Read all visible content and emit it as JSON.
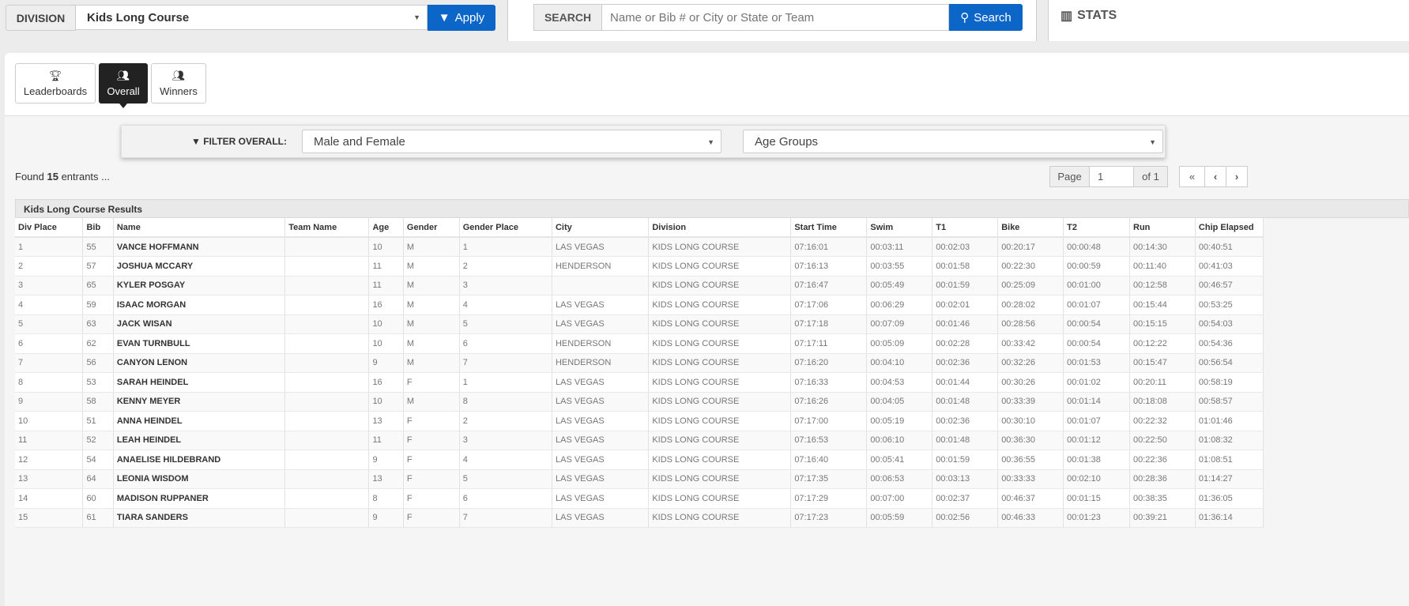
{
  "division": {
    "label": "DIVISION",
    "selected": "Kids Long Course",
    "apply": "Apply"
  },
  "search": {
    "label": "SEARCH",
    "placeholder": "Name or Bib # or City or State or Team",
    "button": "Search"
  },
  "stats": {
    "label": "STATS"
  },
  "tabs": [
    {
      "label": "Leaderboards",
      "icon": "trophy-icon"
    },
    {
      "label": "Overall",
      "icon": "users-icon",
      "active": true
    },
    {
      "label": "Winners",
      "icon": "users-icon"
    }
  ],
  "filter": {
    "label": "FILTER OVERALL:",
    "gender": "Male and Female",
    "age": "Age Groups"
  },
  "found": {
    "prefix": "Found ",
    "count": "15",
    "suffix": " entrants ..."
  },
  "pagination": {
    "page_label": "Page",
    "page": "1",
    "of": "of 1"
  },
  "results": {
    "title": "Kids Long Course Results",
    "columns": [
      "Div Place",
      "Bib",
      "Name",
      "Team Name",
      "Age",
      "Gender",
      "Gender Place",
      "City",
      "Division",
      "Start Time",
      "Swim",
      "T1",
      "Bike",
      "T2",
      "Run",
      "Chip Elapsed"
    ],
    "rows": [
      [
        "1",
        "55",
        "VANCE HOFFMANN",
        "",
        "10",
        "M",
        "1",
        "LAS VEGAS",
        "KIDS LONG COURSE",
        "07:16:01",
        "00:03:11",
        "00:02:03",
        "00:20:17",
        "00:00:48",
        "00:14:30",
        "00:40:51"
      ],
      [
        "2",
        "57",
        "JOSHUA MCCARY",
        "",
        "11",
        "M",
        "2",
        "HENDERSON",
        "KIDS LONG COURSE",
        "07:16:13",
        "00:03:55",
        "00:01:58",
        "00:22:30",
        "00:00:59",
        "00:11:40",
        "00:41:03"
      ],
      [
        "3",
        "65",
        "KYLER POSGAY",
        "",
        "11",
        "M",
        "3",
        "",
        "KIDS LONG COURSE",
        "07:16:47",
        "00:05:49",
        "00:01:59",
        "00:25:09",
        "00:01:00",
        "00:12:58",
        "00:46:57"
      ],
      [
        "4",
        "59",
        "ISAAC MORGAN",
        "",
        "16",
        "M",
        "4",
        "LAS VEGAS",
        "KIDS LONG COURSE",
        "07:17:06",
        "00:06:29",
        "00:02:01",
        "00:28:02",
        "00:01:07",
        "00:15:44",
        "00:53:25"
      ],
      [
        "5",
        "63",
        "JACK WISAN",
        "",
        "10",
        "M",
        "5",
        "LAS VEGAS",
        "KIDS LONG COURSE",
        "07:17:18",
        "00:07:09",
        "00:01:46",
        "00:28:56",
        "00:00:54",
        "00:15:15",
        "00:54:03"
      ],
      [
        "6",
        "62",
        "EVAN TURNBULL",
        "",
        "10",
        "M",
        "6",
        "HENDERSON",
        "KIDS LONG COURSE",
        "07:17:11",
        "00:05:09",
        "00:02:28",
        "00:33:42",
        "00:00:54",
        "00:12:22",
        "00:54:36"
      ],
      [
        "7",
        "56",
        "CANYON LENON",
        "",
        "9",
        "M",
        "7",
        "HENDERSON",
        "KIDS LONG COURSE",
        "07:16:20",
        "00:04:10",
        "00:02:36",
        "00:32:26",
        "00:01:53",
        "00:15:47",
        "00:56:54"
      ],
      [
        "8",
        "53",
        "SARAH HEINDEL",
        "",
        "16",
        "F",
        "1",
        "LAS VEGAS",
        "KIDS LONG COURSE",
        "07:16:33",
        "00:04:53",
        "00:01:44",
        "00:30:26",
        "00:01:02",
        "00:20:11",
        "00:58:19"
      ],
      [
        "9",
        "58",
        "KENNY MEYER",
        "",
        "10",
        "M",
        "8",
        "LAS VEGAS",
        "KIDS LONG COURSE",
        "07:16:26",
        "00:04:05",
        "00:01:48",
        "00:33:39",
        "00:01:14",
        "00:18:08",
        "00:58:57"
      ],
      [
        "10",
        "51",
        "ANNA HEINDEL",
        "",
        "13",
        "F",
        "2",
        "LAS VEGAS",
        "KIDS LONG COURSE",
        "07:17:00",
        "00:05:19",
        "00:02:36",
        "00:30:10",
        "00:01:07",
        "00:22:32",
        "01:01:46"
      ],
      [
        "11",
        "52",
        "LEAH HEINDEL",
        "",
        "11",
        "F",
        "3",
        "LAS VEGAS",
        "KIDS LONG COURSE",
        "07:16:53",
        "00:06:10",
        "00:01:48",
        "00:36:30",
        "00:01:12",
        "00:22:50",
        "01:08:32"
      ],
      [
        "12",
        "54",
        "ANAELISE HILDEBRAND",
        "",
        "9",
        "F",
        "4",
        "LAS VEGAS",
        "KIDS LONG COURSE",
        "07:16:40",
        "00:05:41",
        "00:01:59",
        "00:36:55",
        "00:01:38",
        "00:22:36",
        "01:08:51"
      ],
      [
        "13",
        "64",
        "LEONIA WISDOM",
        "",
        "13",
        "F",
        "5",
        "LAS VEGAS",
        "KIDS LONG COURSE",
        "07:17:35",
        "00:06:53",
        "00:03:13",
        "00:33:33",
        "00:02:10",
        "00:28:36",
        "01:14:27"
      ],
      [
        "14",
        "60",
        "MADISON RUPPANER",
        "",
        "8",
        "F",
        "6",
        "LAS VEGAS",
        "KIDS LONG COURSE",
        "07:17:29",
        "00:07:00",
        "00:02:37",
        "00:46:37",
        "00:01:15",
        "00:38:35",
        "01:36:05"
      ],
      [
        "15",
        "61",
        "TIARA SANDERS",
        "",
        "9",
        "F",
        "7",
        "LAS VEGAS",
        "KIDS LONG COURSE",
        "07:17:23",
        "00:05:59",
        "00:02:56",
        "00:46:33",
        "00:01:23",
        "00:39:21",
        "01:36:14"
      ]
    ]
  }
}
